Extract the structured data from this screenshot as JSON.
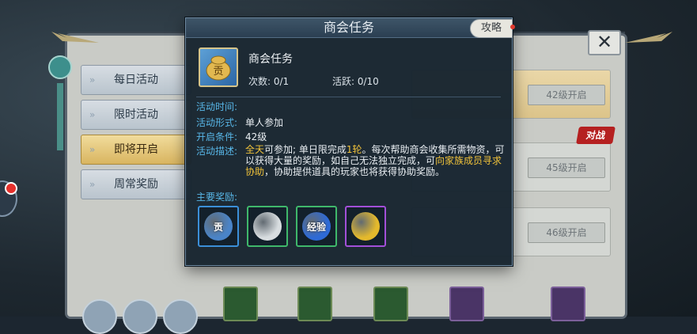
{
  "background": {
    "close_glyph": "✕",
    "tabs": [
      {
        "label": "每日活动",
        "active": false
      },
      {
        "label": "限时活动",
        "active": false
      },
      {
        "label": "即将开启",
        "active": true
      },
      {
        "label": "周常奖励",
        "active": false
      }
    ],
    "cards": [
      {
        "level_label": "42级开启"
      },
      {
        "level_label": "45级开启"
      },
      {
        "level_label": "46级开启"
      }
    ],
    "fight_badge": "对战"
  },
  "dialog": {
    "title": "商会任务",
    "guide_label": "攻略",
    "task_name": "商会任务",
    "icon_glyph": "贡",
    "count_label": "次数: 0/1",
    "activity_label": "活跃: 0/10",
    "rows": [
      {
        "label": "活动时间:",
        "value": ""
      },
      {
        "label": "活动形式:",
        "value": "单人参加"
      },
      {
        "label": "开启条件:",
        "value": "42级"
      },
      {
        "label": "活动描述:",
        "value": ""
      }
    ],
    "description": {
      "p1_highlight": "全天",
      "p2": "可参加; 单日限完成",
      "p3_highlight": "1轮",
      "p4": "。每次帮助商会收集所需物资，可以获得大量的奖励，如自己无法独立完成，可",
      "p5_highlight": "向家族成员寻求协助",
      "p6": "，协助提供道具的玩家也将获得协助奖励。"
    },
    "rewards_label": "主要奖励:",
    "rewards": [
      {
        "name": "contribution-token",
        "text": "贡",
        "border": "#3b8fd8",
        "color": "#4a84c8"
      },
      {
        "name": "silver-coin",
        "text": "",
        "border": "#3fb86b",
        "color": "#d8dde0"
      },
      {
        "name": "experience",
        "text": "经验",
        "border": "#3fb86b",
        "color": "#2e6ad6"
      },
      {
        "name": "gold-coin",
        "text": "",
        "border": "#a24fd8",
        "color": "#e4b92c"
      }
    ]
  }
}
